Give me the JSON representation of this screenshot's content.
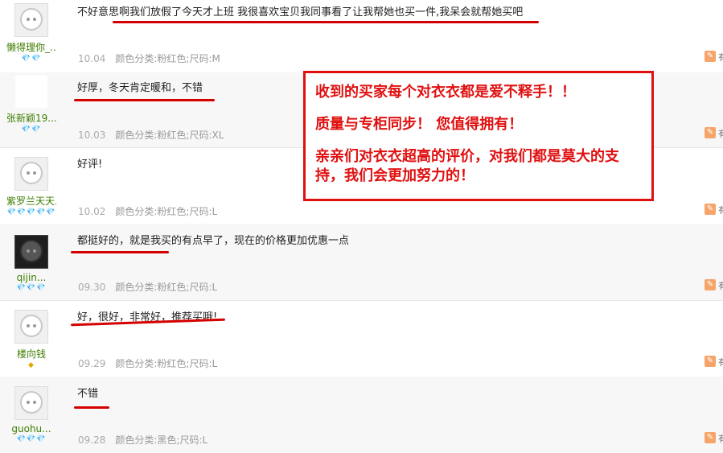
{
  "reviews": [
    {
      "username": "懒得理你_...",
      "rank": "💎💎",
      "content": "不好意思啊我们放假了今天才上班 我很喜欢宝贝我同事看了让我帮她也买一件,我呆会就帮她买吧",
      "date": "10.04",
      "spec": "颜色分类:粉红色;尺码:M",
      "side": "有"
    },
    {
      "username": "张新颖19...",
      "rank": "💎💎",
      "content": "好厚，冬天肯定暖和，不错",
      "date": "10.03",
      "spec": "颜色分类:粉红色;尺码:XL",
      "side": "有"
    },
    {
      "username": "紫罗兰天天...",
      "rank": "💎💎💎💎💎",
      "content": "好评!",
      "date": "10.02",
      "spec": "颜色分类:粉红色;尺码:L",
      "side": "有"
    },
    {
      "username": "qijin...",
      "rank": "💎💎💎",
      "content": "都挺好的，就是我买的有点早了，现在的价格更加优惠一点",
      "date": "09.30",
      "spec": "颜色分类:粉红色;尺码:L",
      "side": "有"
    },
    {
      "username": "楼向钱",
      "rank": "◆",
      "content": "好，很好，非常好，推荐买哦!",
      "date": "09.29",
      "spec": "颜色分类:粉红色;尺码:L",
      "side": "有"
    },
    {
      "username": "guohu...",
      "rank": "💎💎💎",
      "content": "不错",
      "date": "09.28",
      "spec": "颜色分类:黑色;尺码:L",
      "side": "有"
    }
  ],
  "promo": {
    "line1": "收到的买家每个对衣衣都是爱不释手！！",
    "line2": "质量与专柜同步！ 您值得拥有！",
    "line3": "亲亲们对衣衣超高的评价，对我们都是莫大的支持，我们会更加努力的！"
  },
  "colors": {
    "accent": "#e01010",
    "username": "#3d7d00",
    "meta": "#999999"
  },
  "icons": {
    "avatar": "default-avatar-icon",
    "rank": "diamond-icon",
    "side": "comment-icon"
  }
}
